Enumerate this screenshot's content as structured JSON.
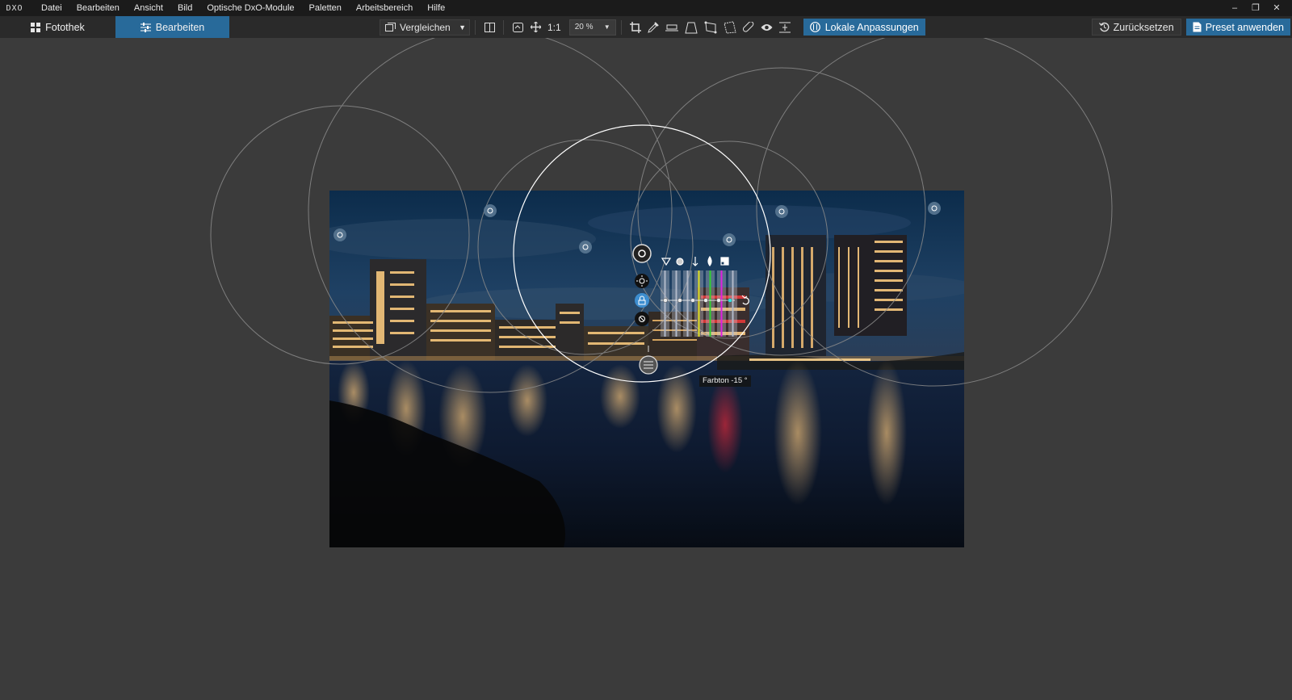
{
  "app": {
    "logo": "DXO",
    "menu": [
      "Datei",
      "Bearbeiten",
      "Ansicht",
      "Bild",
      "Optische DxO-Module",
      "Paletten",
      "Arbeitsbereich",
      "Hilfe"
    ],
    "window_controls": [
      "–",
      "❐",
      "✕"
    ]
  },
  "toolbar": {
    "tab_library": "Fotothek",
    "tab_edit": "Bearbeiten",
    "compare_label": "Vergleichen",
    "one_to_one": "1:1",
    "zoom": "20 %",
    "local_adjustments": "Lokale Anpassungen",
    "reset": "Zurücksetzen",
    "preset": "Preset anwenden"
  },
  "colors": {
    "accent": "#286a9a",
    "menubar": "#1b1b1b",
    "toolbar": "#2a2a2a",
    "canvas": "#3b3b3b",
    "handle": "#9ec4e0"
  },
  "control_point": {
    "tooltip": "Farbton -15 °",
    "icons": [
      "target-icon",
      "sun-icon",
      "lock-icon",
      "wand-icon",
      "triangle-icon",
      "circle-icon",
      "arrow-down-icon",
      "drop-icon",
      "chroma-icon",
      "undo-icon",
      "handle-icon"
    ],
    "slider_colors": [
      "#b0b8c8",
      "#b0b8c8",
      "#b0b8c8",
      "#e0e020",
      "#30d030",
      "#e020e0",
      "#b0b8c8"
    ]
  }
}
